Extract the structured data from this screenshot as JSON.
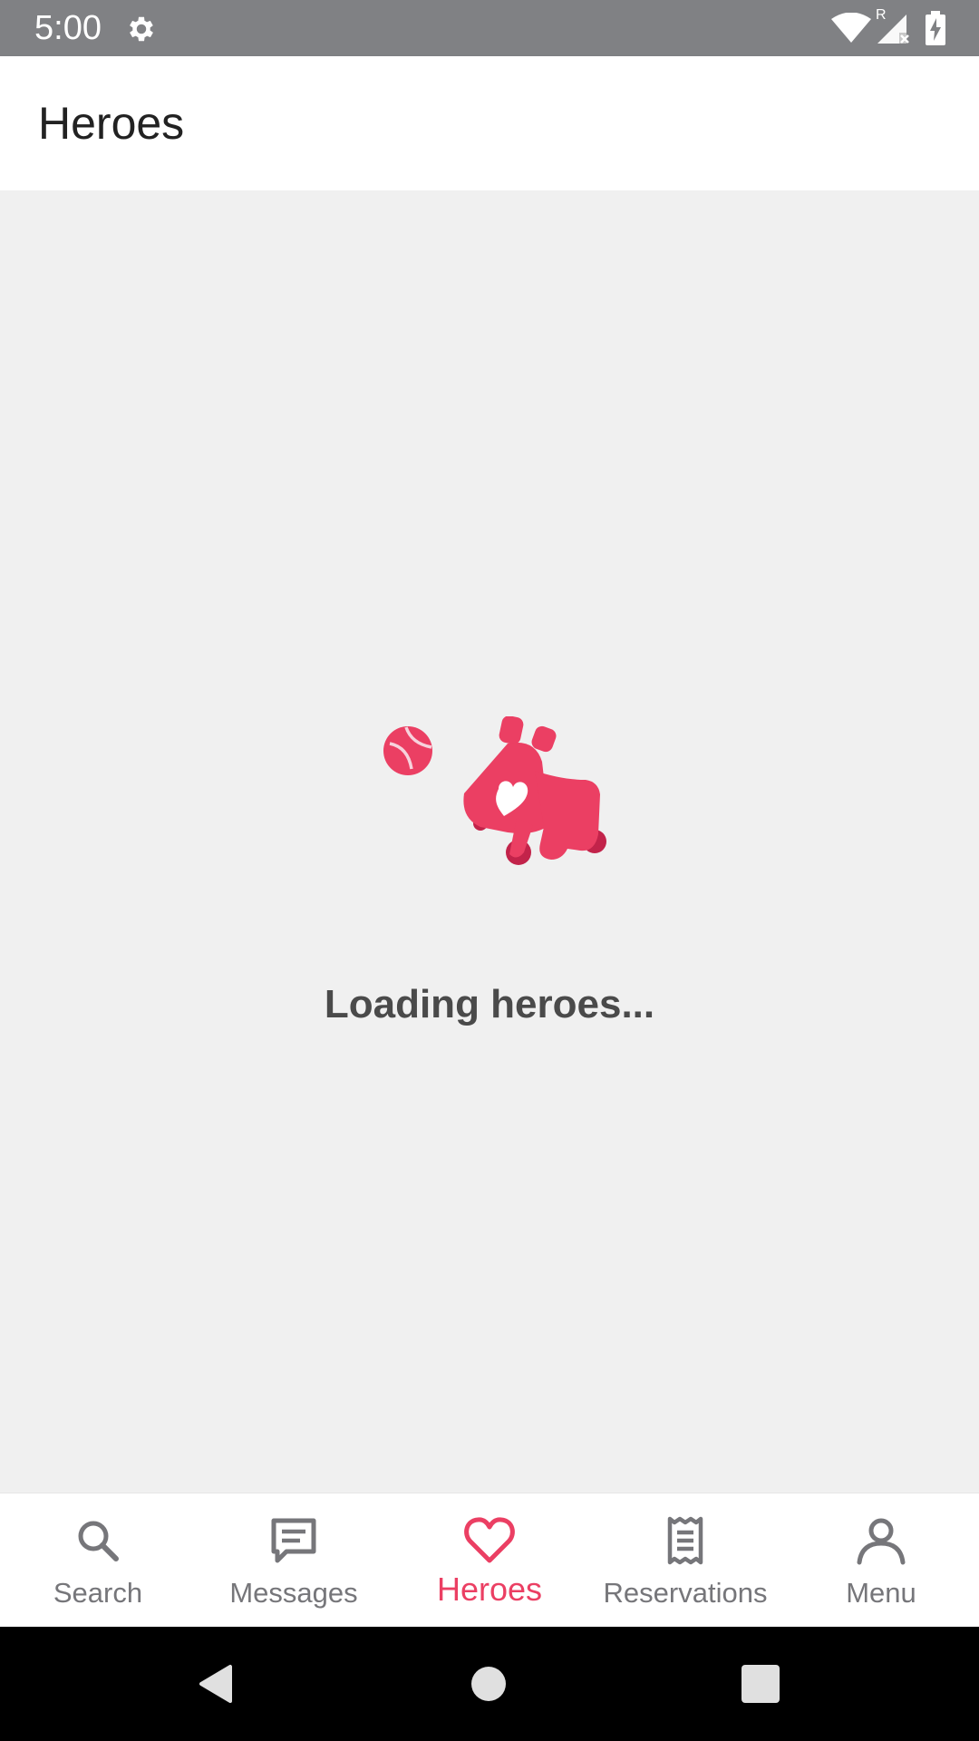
{
  "status_bar": {
    "time": "5:00",
    "icons": [
      "gear-icon",
      "wifi-icon",
      "signal-roaming-icon",
      "battery-charging-icon"
    ],
    "roaming_label": "R"
  },
  "app_bar": {
    "title": "Heroes"
  },
  "content": {
    "loading_text": "Loading heroes...",
    "illustration": "dog-with-ball-illustration"
  },
  "bottom_nav": {
    "items": [
      {
        "label": "Search",
        "icon": "search-icon",
        "active": false
      },
      {
        "label": "Messages",
        "icon": "message-icon",
        "active": false
      },
      {
        "label": "Heroes",
        "icon": "heart-icon",
        "active": true
      },
      {
        "label": "Reservations",
        "icon": "receipt-icon",
        "active": false
      },
      {
        "label": "Menu",
        "icon": "person-icon",
        "active": false
      }
    ]
  },
  "system_nav": {
    "buttons": [
      "back-icon",
      "home-icon",
      "recents-icon"
    ]
  },
  "colors": {
    "accent": "#eb3f63",
    "accent_dark": "#c2234a",
    "status_bar": "#808184",
    "inactive": "#76767a",
    "background": "#f0f0f0"
  }
}
